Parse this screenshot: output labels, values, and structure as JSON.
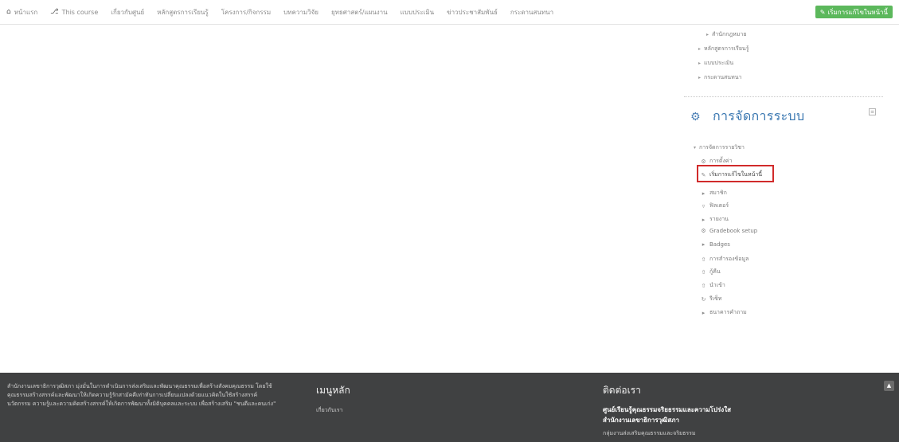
{
  "navbar": {
    "items": [
      {
        "icon": "home-icon",
        "label": "หน้าแรก"
      },
      {
        "icon": "sitemap-icon",
        "label": "This course"
      },
      {
        "label": "เกี่ยวกับศูนย์"
      },
      {
        "label": "หลักสูตรการเรียนรู้"
      },
      {
        "label": "โครงการ/กิจกรรม"
      },
      {
        "label": "บทความวิจัย"
      },
      {
        "label": "ยุทธศาสตร์/แผนงาน"
      },
      {
        "label": "แบบประเมิน"
      },
      {
        "label": "ข่าวประชาสัมพันธ์"
      },
      {
        "label": "กระดานสนทนา"
      }
    ],
    "turn_editing": "เริ่มการแก้ไขในหน้านี้",
    "turn_editing_icon": "edit-icon"
  },
  "sidebar": {
    "tree_top": [
      {
        "label": "สำนักกฎหมาย"
      },
      {
        "label": "หลักสูตรการเรียนรู้"
      },
      {
        "label": "แบบประเมิน"
      },
      {
        "label": "กระดานสนทนา"
      }
    ],
    "admin_block": {
      "title": "การจัดการระบบ",
      "icon": "gears-icon",
      "root": "การจัดการรายวิชา",
      "items": [
        {
          "icon": "gear-icon",
          "label": "การตั้งค่า"
        },
        {
          "icon": "pencil-icon",
          "label": "เริ่มการแก้ไขในหน้านี้"
        },
        {
          "icon": "arrow-icon",
          "label": "สมาชิก"
        },
        {
          "icon": "filter-icon",
          "label": "ฟิลเตอร์"
        },
        {
          "icon": "arrow-icon",
          "label": "รายงาน"
        },
        {
          "icon": "gear-icon",
          "label": "Gradebook setup"
        },
        {
          "icon": "arrow-icon",
          "label": "Badges"
        },
        {
          "icon": "upload-icon",
          "label": "การสำรองข้อมูล"
        },
        {
          "icon": "upload-icon",
          "label": "กู้คืน"
        },
        {
          "icon": "upload-icon",
          "label": "นำเข้า"
        },
        {
          "icon": "refresh-icon",
          "label": "รีเซ็ท"
        },
        {
          "icon": "arrow-icon",
          "label": "ธนาคารคำถาม"
        }
      ]
    }
  },
  "footer": {
    "about": "สำนักงานเลขาธิการวุฒิสภา มุ่งมั่นในการดำเนินการส่งเสริมและพัฒนาคุณธรรมเพื่อสร้างสังคมคุณธรรม โดยใช้คุณธรรมสร้างสรรค์และพัฒนาให้เกิดความรู้รักสามัคคีเท่าทันการเปลี่ยนแปลงด้วยแนวคิดในใช้สร้างสรรค์นวัตกรรม ความรู้และความคิดสร้างสรรค์ให้เกิดการพัฒนาทั้งมิติบุคคลและระบบ เพื่อสร้างเสริม \"ชนดีและคนเก่ง\"",
    "menu_title": "เมนูหลัก",
    "menu_link": "เกี่ยวกับเรา",
    "contact_title": "ติดต่อเรา",
    "org_line1": "ศูนย์เรียนรู้คุณธรรมจริยธรรมและความโปร่งใส",
    "org_line2": "สำนักงานเลขาธิการวุฒิสภา",
    "org_sub": "กลุ่มงานส่งเสริมคุณธรรมและจริยธรรม",
    "back_to_top_icon": "chevron-up-icon"
  }
}
